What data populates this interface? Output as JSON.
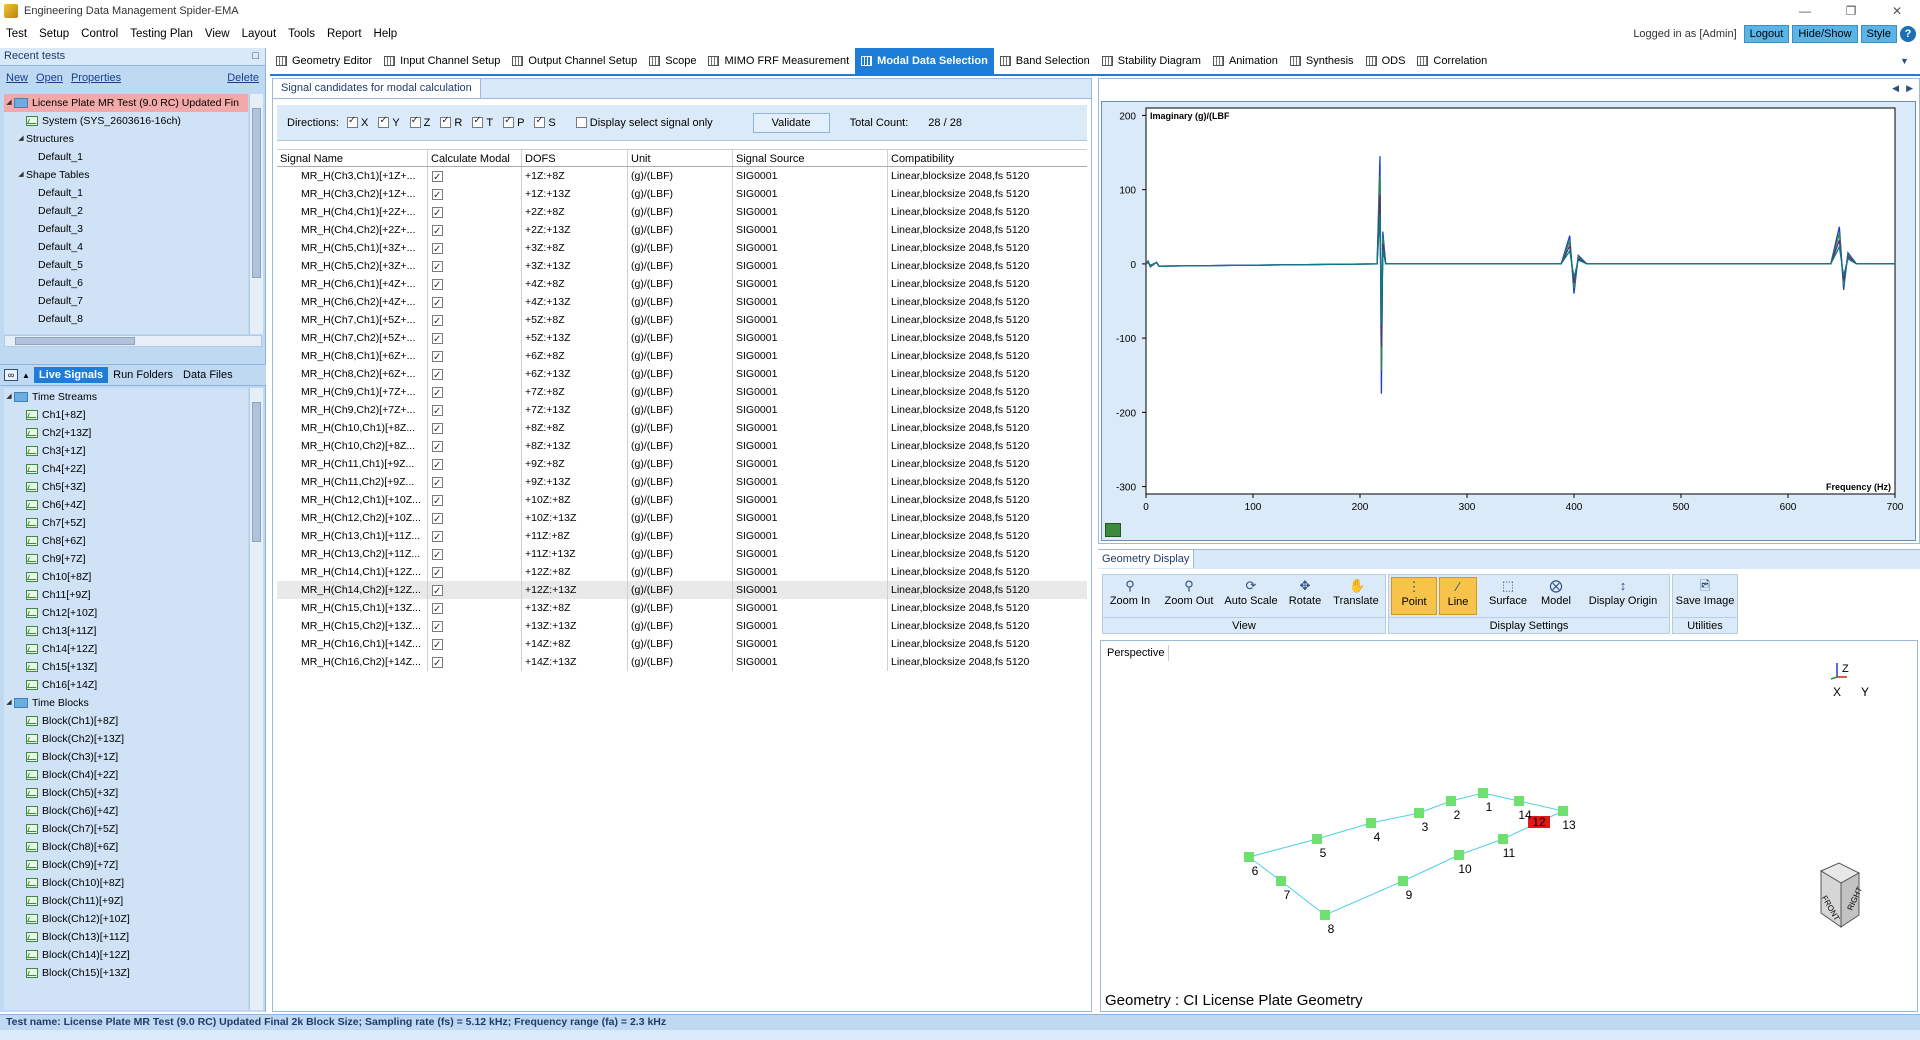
{
  "window": {
    "title": "Engineering Data Management Spider-EMA"
  },
  "menu": [
    "Test",
    "Setup",
    "Control",
    "Testing Plan",
    "View",
    "Layout",
    "Tools",
    "Report",
    "Help"
  ],
  "session": {
    "logged_in": "Logged in as [Admin]",
    "logout": "Logout",
    "hide_show": "Hide/Show",
    "style": "Style",
    "help": "?"
  },
  "recent": {
    "header": "Recent tests",
    "links": {
      "new": "New",
      "open": "Open",
      "properties": "Properties",
      "delete": "Delete"
    },
    "tree": [
      {
        "label": "License Plate MR Test (9.0 RC) Updated Fin",
        "level": 0,
        "selected": true
      },
      {
        "label": "System (SYS_2603616-16ch)",
        "level": 1
      },
      {
        "label": "Structures",
        "level": 1
      },
      {
        "label": "Default_1",
        "level": 2
      },
      {
        "label": "Shape Tables",
        "level": 1
      },
      {
        "label": "Default_1",
        "level": 2
      },
      {
        "label": "Default_2",
        "level": 2
      },
      {
        "label": "Default_3",
        "level": 2
      },
      {
        "label": "Default_4",
        "level": 2
      },
      {
        "label": "Default_5",
        "level": 2
      },
      {
        "label": "Default_6",
        "level": 2
      },
      {
        "label": "Default_7",
        "level": 2
      },
      {
        "label": "Default_8",
        "level": 2
      }
    ]
  },
  "signal_tabs": [
    "Live Signals",
    "Run Folders",
    "Data Files"
  ],
  "signals": {
    "time_streams_label": "Time Streams",
    "time_streams": [
      "Ch1[+8Z]",
      "Ch2[+13Z]",
      "Ch3[+1Z]",
      "Ch4[+2Z]",
      "Ch5[+3Z]",
      "Ch6[+4Z]",
      "Ch7[+5Z]",
      "Ch8[+6Z]",
      "Ch9[+7Z]",
      "Ch10[+8Z]",
      "Ch11[+9Z]",
      "Ch12[+10Z]",
      "Ch13[+11Z]",
      "Ch14[+12Z]",
      "Ch15[+13Z]",
      "Ch16[+14Z]"
    ],
    "time_blocks_label": "Time Blocks",
    "time_blocks": [
      "Block(Ch1)[+8Z]",
      "Block(Ch2)[+13Z]",
      "Block(Ch3)[+1Z]",
      "Block(Ch4)[+2Z]",
      "Block(Ch5)[+3Z]",
      "Block(Ch6)[+4Z]",
      "Block(Ch7)[+5Z]",
      "Block(Ch8)[+6Z]",
      "Block(Ch9)[+7Z]",
      "Block(Ch10)[+8Z]",
      "Block(Ch11)[+9Z]",
      "Block(Ch12)[+10Z]",
      "Block(Ch13)[+11Z]",
      "Block(Ch14)[+12Z]",
      "Block(Ch15)[+13Z]"
    ]
  },
  "top_tabs": [
    "Geometry Editor",
    "Input Channel Setup",
    "Output Channel Setup",
    "Scope",
    "MIMO FRF Measurement",
    "Modal Data Selection",
    "Band Selection",
    "Stability Diagram",
    "Animation",
    "Synthesis",
    "ODS",
    "Correlation"
  ],
  "active_tab": "Modal Data Selection",
  "candidates": {
    "tab": "Signal candidates for modal calculation",
    "directions_label": "Directions:",
    "directions": [
      "X",
      "Y",
      "Z",
      "R",
      "T",
      "P",
      "S"
    ],
    "display_selected": "Display select signal only",
    "validate": "Validate",
    "total_count_label": "Total Count:",
    "total_count": "28 / 28",
    "columns": [
      "Signal Name",
      "Calculate Modal",
      "DOFS",
      "Unit",
      "Signal Source",
      "Compatibility"
    ],
    "rows": [
      [
        "MR_H(Ch3,Ch1)[+1Z+...",
        "+1Z:+8Z",
        "(g)/(LBF)",
        "SIG0001",
        "Linear,blocksize 2048,fs 5120"
      ],
      [
        "MR_H(Ch3,Ch2)[+1Z+...",
        "+1Z:+13Z",
        "(g)/(LBF)",
        "SIG0001",
        "Linear,blocksize 2048,fs 5120"
      ],
      [
        "MR_H(Ch4,Ch1)[+2Z+...",
        "+2Z:+8Z",
        "(g)/(LBF)",
        "SIG0001",
        "Linear,blocksize 2048,fs 5120"
      ],
      [
        "MR_H(Ch4,Ch2)[+2Z+...",
        "+2Z:+13Z",
        "(g)/(LBF)",
        "SIG0001",
        "Linear,blocksize 2048,fs 5120"
      ],
      [
        "MR_H(Ch5,Ch1)[+3Z+...",
        "+3Z:+8Z",
        "(g)/(LBF)",
        "SIG0001",
        "Linear,blocksize 2048,fs 5120"
      ],
      [
        "MR_H(Ch5,Ch2)[+3Z+...",
        "+3Z:+13Z",
        "(g)/(LBF)",
        "SIG0001",
        "Linear,blocksize 2048,fs 5120"
      ],
      [
        "MR_H(Ch6,Ch1)[+4Z+...",
        "+4Z:+8Z",
        "(g)/(LBF)",
        "SIG0001",
        "Linear,blocksize 2048,fs 5120"
      ],
      [
        "MR_H(Ch6,Ch2)[+4Z+...",
        "+4Z:+13Z",
        "(g)/(LBF)",
        "SIG0001",
        "Linear,blocksize 2048,fs 5120"
      ],
      [
        "MR_H(Ch7,Ch1)[+5Z+...",
        "+5Z:+8Z",
        "(g)/(LBF)",
        "SIG0001",
        "Linear,blocksize 2048,fs 5120"
      ],
      [
        "MR_H(Ch7,Ch2)[+5Z+...",
        "+5Z:+13Z",
        "(g)/(LBF)",
        "SIG0001",
        "Linear,blocksize 2048,fs 5120"
      ],
      [
        "MR_H(Ch8,Ch1)[+6Z+...",
        "+6Z:+8Z",
        "(g)/(LBF)",
        "SIG0001",
        "Linear,blocksize 2048,fs 5120"
      ],
      [
        "MR_H(Ch8,Ch2)[+6Z+...",
        "+6Z:+13Z",
        "(g)/(LBF)",
        "SIG0001",
        "Linear,blocksize 2048,fs 5120"
      ],
      [
        "MR_H(Ch9,Ch1)[+7Z+...",
        "+7Z:+8Z",
        "(g)/(LBF)",
        "SIG0001",
        "Linear,blocksize 2048,fs 5120"
      ],
      [
        "MR_H(Ch9,Ch2)[+7Z+...",
        "+7Z:+13Z",
        "(g)/(LBF)",
        "SIG0001",
        "Linear,blocksize 2048,fs 5120"
      ],
      [
        "MR_H(Ch10,Ch1)[+8Z...",
        "+8Z:+8Z",
        "(g)/(LBF)",
        "SIG0001",
        "Linear,blocksize 2048,fs 5120"
      ],
      [
        "MR_H(Ch10,Ch2)[+8Z...",
        "+8Z:+13Z",
        "(g)/(LBF)",
        "SIG0001",
        "Linear,blocksize 2048,fs 5120"
      ],
      [
        "MR_H(Ch11,Ch1)[+9Z...",
        "+9Z:+8Z",
        "(g)/(LBF)",
        "SIG0001",
        "Linear,blocksize 2048,fs 5120"
      ],
      [
        "MR_H(Ch11,Ch2)[+9Z...",
        "+9Z:+13Z",
        "(g)/(LBF)",
        "SIG0001",
        "Linear,blocksize 2048,fs 5120"
      ],
      [
        "MR_H(Ch12,Ch1)[+10Z...",
        "+10Z:+8Z",
        "(g)/(LBF)",
        "SIG0001",
        "Linear,blocksize 2048,fs 5120"
      ],
      [
        "MR_H(Ch12,Ch2)[+10Z...",
        "+10Z:+13Z",
        "(g)/(LBF)",
        "SIG0001",
        "Linear,blocksize 2048,fs 5120"
      ],
      [
        "MR_H(Ch13,Ch1)[+11Z...",
        "+11Z:+8Z",
        "(g)/(LBF)",
        "SIG0001",
        "Linear,blocksize 2048,fs 5120"
      ],
      [
        "MR_H(Ch13,Ch2)[+11Z...",
        "+11Z:+13Z",
        "(g)/(LBF)",
        "SIG0001",
        "Linear,blocksize 2048,fs 5120"
      ],
      [
        "MR_H(Ch14,Ch1)[+12Z...",
        "+12Z:+8Z",
        "(g)/(LBF)",
        "SIG0001",
        "Linear,blocksize 2048,fs 5120"
      ],
      [
        "MR_H(Ch14,Ch2)[+12Z...",
        "+12Z:+13Z",
        "(g)/(LBF)",
        "SIG0001",
        "Linear,blocksize 2048,fs 5120"
      ],
      [
        "MR_H(Ch15,Ch1)[+13Z...",
        "+13Z:+8Z",
        "(g)/(LBF)",
        "SIG0001",
        "Linear,blocksize 2048,fs 5120"
      ],
      [
        "MR_H(Ch15,Ch2)[+13Z...",
        "+13Z:+13Z",
        "(g)/(LBF)",
        "SIG0001",
        "Linear,blocksize 2048,fs 5120"
      ],
      [
        "MR_H(Ch16,Ch1)[+14Z...",
        "+14Z:+8Z",
        "(g)/(LBF)",
        "SIG0001",
        "Linear,blocksize 2048,fs 5120"
      ],
      [
        "MR_H(Ch16,Ch2)[+14Z...",
        "+14Z:+13Z",
        "(g)/(LBF)",
        "SIG0001",
        "Linear,blocksize 2048,fs 5120"
      ]
    ],
    "selected_row": 23
  },
  "chart_data": {
    "type": "line",
    "title": "",
    "ylabel": "Imaginary (g)/(LBF",
    "xlabel": "Frequency (Hz)",
    "xlim": [
      0,
      700
    ],
    "ylim": [
      -310,
      210
    ],
    "xticks": [
      0,
      100,
      200,
      300,
      400,
      500,
      600,
      700
    ],
    "yticks": [
      200,
      100,
      0,
      -100,
      -200,
      -300
    ],
    "peaks": [
      {
        "x": 220,
        "ymax": 145,
        "ymin": -175
      },
      {
        "x": 400,
        "ymax": 38,
        "ymin": -40
      },
      {
        "x": 652,
        "ymax": 50,
        "ymin": -35
      }
    ],
    "colors": [
      "#1a3fd0",
      "#2e8b3e",
      "#5a2e78",
      "#0b7a8a"
    ]
  },
  "geometry": {
    "tab": "Geometry Display",
    "view_buttons": [
      "Zoom In",
      "Zoom Out",
      "Auto Scale",
      "Rotate",
      "Translate"
    ],
    "view_label": "View",
    "display_buttons": [
      "Point",
      "Line",
      "Surface",
      "Model",
      "Display Origin"
    ],
    "display_label": "Display Settings",
    "util_buttons": [
      "Save Image"
    ],
    "util_label": "Utilities",
    "perspective": "Perspective",
    "caption": "Geometry : CI License Plate Geometry",
    "axes": {
      "z": "Z",
      "x": "X",
      "y": "Y"
    },
    "cube_labels": [
      "FRONT",
      "RIGHT"
    ],
    "nodes": [
      "1",
      "2",
      "3",
      "4",
      "5",
      "6",
      "7",
      "8",
      "9",
      "10",
      "11",
      "12",
      "13",
      "14"
    ],
    "highlight_node": "12"
  },
  "status": "Test name: License Plate MR Test (9.0 RC) Updated Final 2k Block Size; Sampling rate (fs) = 5.12 kHz; Frequency range (fa) = 2.3 kHz"
}
